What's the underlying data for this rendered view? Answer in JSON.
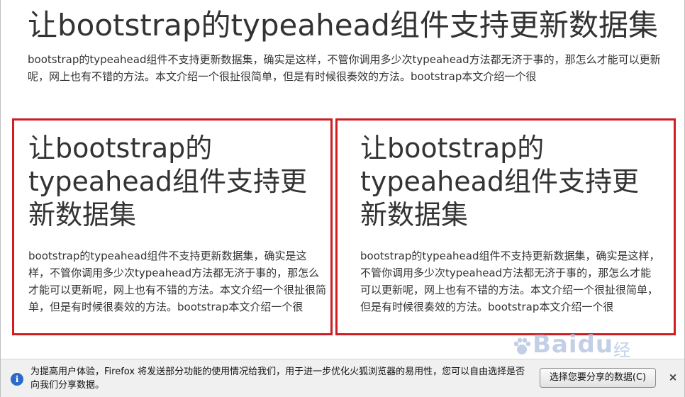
{
  "article": {
    "title": "让bootstrap的typeahead组件支持更新数据集",
    "paragraph": "bootstrap的typeahead组件不支持更新数据集，确实是这样，不管你调用多少次typeahead方法都无济于事的，那怎么才能可以更新呢，网上也有不错的方法。本文介绍一个很扯很简单，但是有时候很奏效的方法。bootstrap本文介绍一个很"
  },
  "panels": {
    "left": {
      "title": "让bootstrap的typeahead组件支持更新数据集",
      "text": "bootstrap的typeahead组件不支持更新数据集，确实是这样，不管你调用多少次typeahead方法都无济于事的，那怎么才能可以更新呢，网上也有不错的方法。本文介绍一个很扯很简单，但是有时候很奏效的方法。bootstrap本文介绍一个很"
    },
    "right": {
      "title": "让bootstrap的typeahead组件支持更新数据集",
      "text": "bootstrap的typeahead组件不支持更新数据集，确实是这样，不管你调用多少次typeahead方法都无济于事的，那怎么才能可以更新呢，网上也有不错的方法。本文介绍一个很扯很简单，但是有时候很奏效的方法。bootstrap本文介绍一个很"
    },
    "border_color": "#cf1d24"
  },
  "watermark": {
    "brand": "Baidu",
    "sub": "经验"
  },
  "notice": {
    "text": "为提高用户体验，Firefox 将发送部分功能的使用情况给我们，用于进一步优化火狐浏览器的易用性，您可以自由选择是否向我们分享数据。",
    "button_label": "选择您要分享的数据(C)",
    "close_label": "×",
    "info_icon": "info-icon",
    "info_color": "#2d69c8"
  }
}
